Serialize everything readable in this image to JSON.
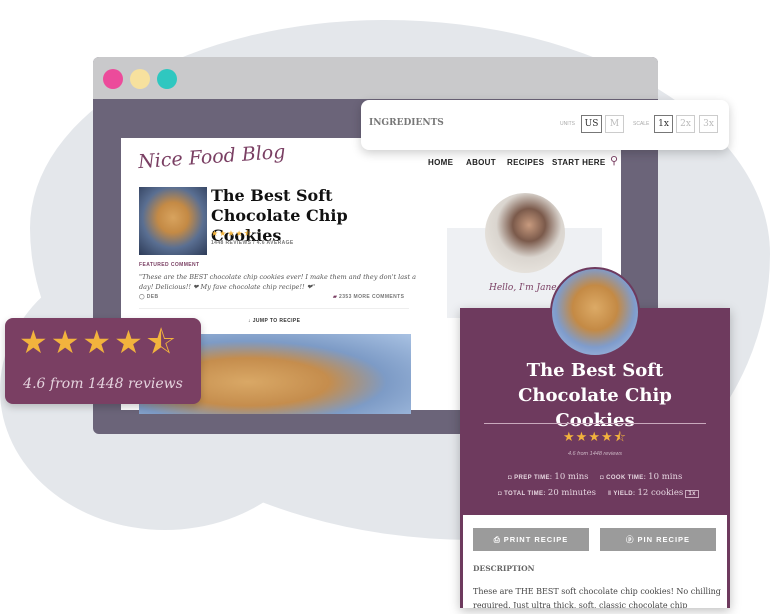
{
  "window": {
    "dot_colors": [
      "#ec4b9b",
      "#f7e19e",
      "#2fc7c0"
    ]
  },
  "blog": {
    "logo": "Nice Food Blog",
    "nav": [
      "HOME",
      "ABOUT",
      "RECIPES",
      "START HERE"
    ],
    "search_icon": "search-icon",
    "post_title": "The Best Soft Chocolate Chip Cookies",
    "rating_stars": 4.5,
    "reviews_line": "1448 REVIEWS / 4.6 AVERAGE",
    "featured_label": "FEATURED COMMENT",
    "featured_quote": "\"These are the BEST chocolate chip cookies ever! I make them and they don't last a day! Delicious!! ❤ My fave chocolate chip recipe!! ❤\"",
    "commenter": "DEB",
    "more_comments": "2353 MORE COMMENTS",
    "jump": "JUMP TO RECIPE",
    "hello": "Hello, I'm Jane"
  },
  "ingredients": {
    "title": "INGREDIENTS",
    "units_label": "UNITS",
    "units": [
      "US",
      "M"
    ],
    "units_selected": "US",
    "scale_label": "SCALE",
    "scale": [
      "1x",
      "2x",
      "3x"
    ],
    "scale_selected": "1x"
  },
  "rating_card": {
    "stars": 4.5,
    "text": "4.6 from 1448 reviews"
  },
  "recipe_card": {
    "title": "The Best Soft Chocolate Chip Cookies",
    "rating_text": "4.6 from 1448 reviews",
    "prep_label": "PREP TIME:",
    "prep": "10 mins",
    "cook_label": "COOK TIME:",
    "cook": "10 mins",
    "total_label": "TOTAL TIME:",
    "total": "20 minutes",
    "yield_label": "YIELD:",
    "yield": "12 cookies",
    "yield_scale": "1x",
    "print": "PRINT RECIPE",
    "pin": "PIN RECIPE",
    "desc_label": "DESCRIPTION",
    "description": "These are THE BEST soft chocolate chip cookies! No chilling required. Just ultra thick, soft, classic chocolate chip cookies!"
  },
  "colors": {
    "brand": "#6e3a5e",
    "star": "#f2b33d"
  }
}
